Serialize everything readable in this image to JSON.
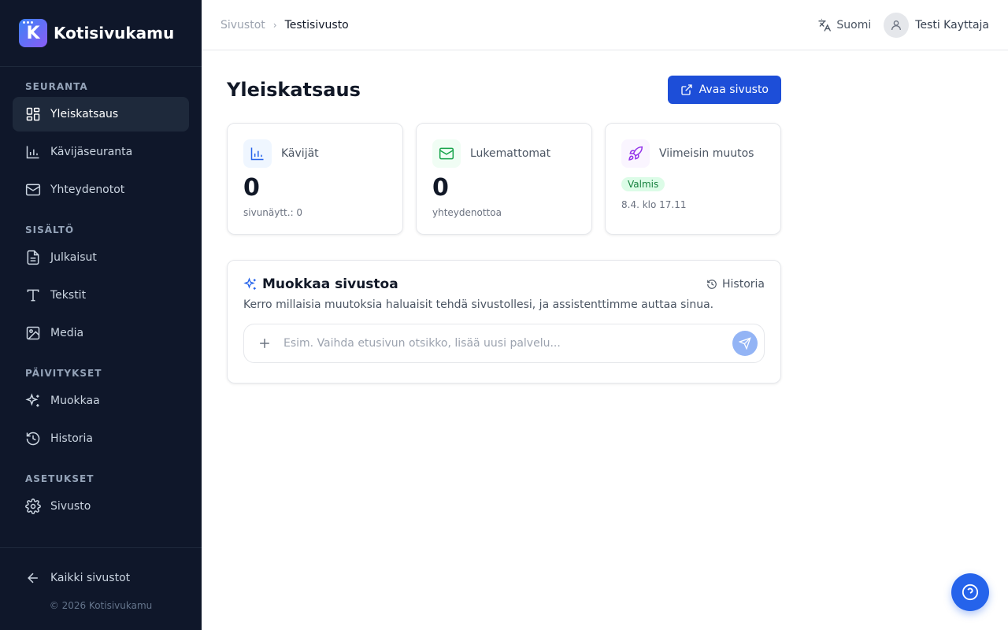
{
  "app": {
    "name": "Kotisivukamu",
    "logo_letter": "K"
  },
  "sidebar": {
    "sections": [
      {
        "label": "SEURANTA",
        "items": [
          {
            "label": "Yleiskatsaus",
            "icon": "dashboard-icon",
            "active": true
          },
          {
            "label": "Kävijäseuranta",
            "icon": "bar-chart-icon"
          },
          {
            "label": "Yhteydenotot",
            "icon": "mail-icon"
          }
        ]
      },
      {
        "label": "SISÄLTÖ",
        "items": [
          {
            "label": "Julkaisut",
            "icon": "document-icon"
          },
          {
            "label": "Tekstit",
            "icon": "text-icon"
          },
          {
            "label": "Media",
            "icon": "image-icon"
          }
        ]
      },
      {
        "label": "PÄIVITYKSET",
        "items": [
          {
            "label": "Muokkaa",
            "icon": "sparkles-icon"
          },
          {
            "label": "Historia",
            "icon": "history-icon"
          }
        ]
      },
      {
        "label": "ASETUKSET",
        "items": [
          {
            "label": "Sivusto",
            "icon": "gear-icon"
          }
        ]
      }
    ],
    "back_label": "Kaikki sivustot",
    "copyright": "© 2026 Kotisivukamu"
  },
  "header": {
    "breadcrumb": {
      "parent": "Sivustot",
      "current": "Testisivusto"
    },
    "language": "Suomi",
    "user_name": "Testi Kayttaja"
  },
  "main": {
    "title": "Yleiskatsaus",
    "open_site_label": "Avaa sivusto",
    "stats": {
      "visitors": {
        "label": "Kävijät",
        "value": "0",
        "sub": "sivunäytt.: 0"
      },
      "unread": {
        "label": "Lukemattomat",
        "value": "0",
        "sub": "yhteydenottoa"
      },
      "last_change": {
        "label": "Viimeisin muutos",
        "badge": "Valmis",
        "time": "8.4. klo 17.11"
      }
    },
    "edit": {
      "title": "Muokkaa sivustoa",
      "history_label": "Historia",
      "description": "Kerro millaisia muutoksia haluaisit tehdä sivustollesi, ja assistenttimme auttaa sinua.",
      "input_value": "",
      "input_placeholder": "Esim. Vaihda etusivun otsikko, lisää uusi palvelu..."
    }
  },
  "colors": {
    "sidebar_bg": "#0f172a",
    "primary": "#1d4ed8",
    "success_bg": "#dcfce7",
    "success_text": "#15803d"
  }
}
